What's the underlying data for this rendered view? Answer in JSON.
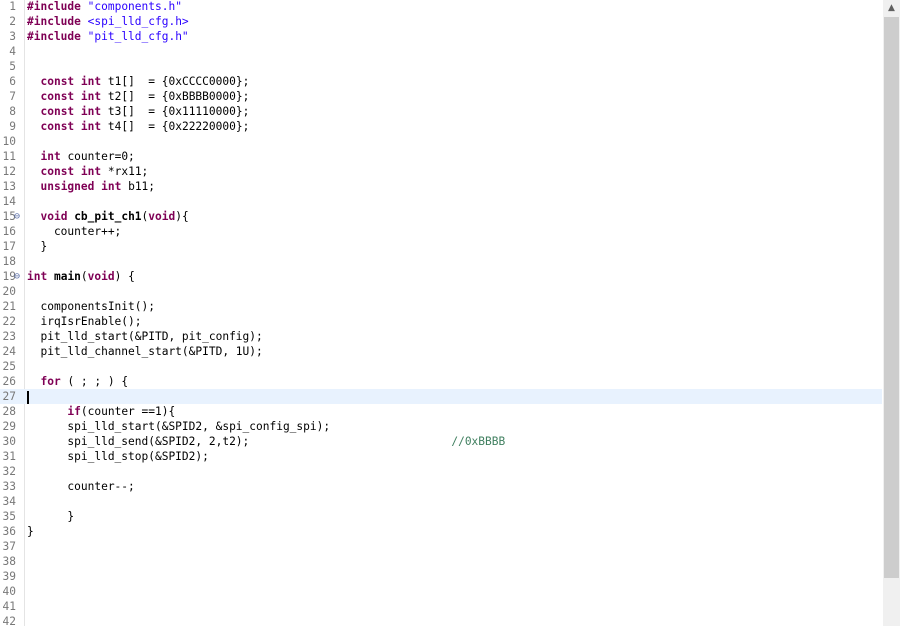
{
  "editor": {
    "lines": [
      {
        "no": "1",
        "fold": "",
        "segs": [
          {
            "t": "#include",
            "c": "kw"
          },
          {
            "t": " "
          },
          {
            "t": "\"components.h\"",
            "c": "str"
          }
        ]
      },
      {
        "no": "2",
        "fold": "",
        "segs": [
          {
            "t": "#include",
            "c": "kw"
          },
          {
            "t": " "
          },
          {
            "t": "<spi_lld_cfg.h>",
            "c": "str"
          }
        ]
      },
      {
        "no": "3",
        "fold": "",
        "segs": [
          {
            "t": "#include",
            "c": "kw"
          },
          {
            "t": " "
          },
          {
            "t": "\"pit_lld_cfg.h\"",
            "c": "str"
          }
        ]
      },
      {
        "no": "4",
        "fold": "",
        "segs": []
      },
      {
        "no": "5",
        "fold": "",
        "segs": []
      },
      {
        "no": "6",
        "fold": "",
        "segs": [
          {
            "t": "  "
          },
          {
            "t": "const",
            "c": "kw"
          },
          {
            "t": " "
          },
          {
            "t": "int",
            "c": "kw"
          },
          {
            "t": " t1[]  = {0xCCCC0000};"
          }
        ]
      },
      {
        "no": "7",
        "fold": "",
        "segs": [
          {
            "t": "  "
          },
          {
            "t": "const",
            "c": "kw"
          },
          {
            "t": " "
          },
          {
            "t": "int",
            "c": "kw"
          },
          {
            "t": " t2[]  = {0xBBBB0000};"
          }
        ]
      },
      {
        "no": "8",
        "fold": "",
        "segs": [
          {
            "t": "  "
          },
          {
            "t": "const",
            "c": "kw"
          },
          {
            "t": " "
          },
          {
            "t": "int",
            "c": "kw"
          },
          {
            "t": " t3[]  = {0x11110000};"
          }
        ]
      },
      {
        "no": "9",
        "fold": "",
        "segs": [
          {
            "t": "  "
          },
          {
            "t": "const",
            "c": "kw"
          },
          {
            "t": " "
          },
          {
            "t": "int",
            "c": "kw"
          },
          {
            "t": " t4[]  = {0x22220000};"
          }
        ]
      },
      {
        "no": "10",
        "fold": "",
        "segs": []
      },
      {
        "no": "11",
        "fold": "",
        "segs": [
          {
            "t": "  "
          },
          {
            "t": "int",
            "c": "kw"
          },
          {
            "t": " counter=0;"
          }
        ]
      },
      {
        "no": "12",
        "fold": "",
        "segs": [
          {
            "t": "  "
          },
          {
            "t": "const",
            "c": "kw"
          },
          {
            "t": " "
          },
          {
            "t": "int",
            "c": "kw"
          },
          {
            "t": " *rx11;"
          }
        ]
      },
      {
        "no": "13",
        "fold": "",
        "segs": [
          {
            "t": "  "
          },
          {
            "t": "unsigned",
            "c": "kw"
          },
          {
            "t": " "
          },
          {
            "t": "int",
            "c": "kw"
          },
          {
            "t": " b11;"
          }
        ]
      },
      {
        "no": "14",
        "fold": "",
        "segs": []
      },
      {
        "no": "15",
        "fold": "⊖",
        "segs": [
          {
            "t": "  "
          },
          {
            "t": "void",
            "c": "kw"
          },
          {
            "t": " "
          },
          {
            "t": "cb_pit_ch1",
            "c": "fn"
          },
          {
            "t": "("
          },
          {
            "t": "void",
            "c": "kw"
          },
          {
            "t": "){"
          }
        ]
      },
      {
        "no": "16",
        "fold": "",
        "segs": [
          {
            "t": "    counter++;"
          }
        ]
      },
      {
        "no": "17",
        "fold": "",
        "segs": [
          {
            "t": "  }"
          }
        ]
      },
      {
        "no": "18",
        "fold": "",
        "segs": []
      },
      {
        "no": "19",
        "fold": "⊖",
        "segs": [
          {
            "t": "int",
            "c": "kw"
          },
          {
            "t": " "
          },
          {
            "t": "main",
            "c": "fn"
          },
          {
            "t": "("
          },
          {
            "t": "void",
            "c": "kw"
          },
          {
            "t": ") {"
          }
        ]
      },
      {
        "no": "20",
        "fold": "",
        "segs": []
      },
      {
        "no": "21",
        "fold": "",
        "segs": [
          {
            "t": "  componentsInit();"
          }
        ]
      },
      {
        "no": "22",
        "fold": "",
        "segs": [
          {
            "t": "  irqIsrEnable();"
          }
        ]
      },
      {
        "no": "23",
        "fold": "",
        "segs": [
          {
            "t": "  pit_lld_start(&PITD, pit_config);"
          }
        ]
      },
      {
        "no": "24",
        "fold": "",
        "segs": [
          {
            "t": "  pit_lld_channel_start(&PITD, 1U);"
          }
        ]
      },
      {
        "no": "25",
        "fold": "",
        "segs": []
      },
      {
        "no": "26",
        "fold": "",
        "segs": [
          {
            "t": "  "
          },
          {
            "t": "for",
            "c": "kw"
          },
          {
            "t": " ( ; ; ) {"
          }
        ]
      },
      {
        "no": "27",
        "fold": "",
        "segs": [],
        "current": true
      },
      {
        "no": "28",
        "fold": "",
        "segs": [
          {
            "t": "      "
          },
          {
            "t": "if",
            "c": "kw"
          },
          {
            "t": "(counter ==1){"
          }
        ]
      },
      {
        "no": "29",
        "fold": "",
        "segs": [
          {
            "t": "      spi_lld_start(&SPID2, &spi_config_spi);"
          }
        ]
      },
      {
        "no": "30",
        "fold": "",
        "segs": [
          {
            "t": "      spi_lld_send(&SPID2, 2,t2);                              "
          },
          {
            "t": "//0xBBBB",
            "c": "cmt"
          }
        ]
      },
      {
        "no": "31",
        "fold": "",
        "segs": [
          {
            "t": "      spi_lld_stop(&SPID2);"
          }
        ]
      },
      {
        "no": "32",
        "fold": "",
        "segs": []
      },
      {
        "no": "33",
        "fold": "",
        "segs": [
          {
            "t": "      counter--;"
          }
        ]
      },
      {
        "no": "34",
        "fold": "",
        "segs": []
      },
      {
        "no": "35",
        "fold": "",
        "segs": [
          {
            "t": "      }"
          }
        ]
      },
      {
        "no": "36",
        "fold": "",
        "segs": [
          {
            "t": "}"
          }
        ]
      },
      {
        "no": "37",
        "fold": "",
        "segs": []
      },
      {
        "no": "38",
        "fold": "",
        "segs": []
      },
      {
        "no": "39",
        "fold": "",
        "segs": []
      },
      {
        "no": "40",
        "fold": "",
        "segs": []
      },
      {
        "no": "41",
        "fold": "",
        "segs": []
      },
      {
        "no": "42",
        "fold": "",
        "segs": []
      }
    ]
  },
  "scrollbar": {
    "up_arrow": "▲"
  },
  "colors": {
    "keyword": "#7f0055",
    "string": "#2a00ff",
    "comment": "#3f7f5f",
    "line_number": "#787878",
    "current_line": "#e8f2fe"
  }
}
